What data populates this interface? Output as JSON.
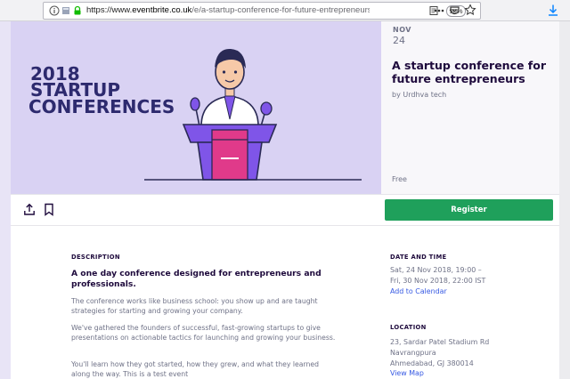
{
  "browser": {
    "url_scheme": "https://www.",
    "url_host": "eventbrite.co.uk",
    "url_path": "/e/a-startup-conference-for-future-entrepreneurs",
    "zoom": "90%"
  },
  "hero": {
    "headline_year": "2018",
    "headline_line1": "STARTUP",
    "headline_line2": "CONFERENCES"
  },
  "event": {
    "month": "NOV",
    "day": "24",
    "title": "A startup conference for future entrepreneurs",
    "organizer": "by Urdhva tech",
    "price": "Free"
  },
  "actions": {
    "register_label": "Register"
  },
  "description": {
    "label": "DESCRIPTION",
    "heading": "A one day conference designed for entrepreneurs and professionals.",
    "paragraphs": [
      "The conference works like business school: you show up and are taught strategies for starting and growing your company.",
      "We've gathered the founders of successful, fast-growing startups to give presentations on actionable tactics for launching and growing your business.",
      "You'll learn how they got started, how they grew, and what they learned along the way. This is a test event"
    ]
  },
  "date_time": {
    "label": "DATE AND TIME",
    "line1": "Sat, 24 Nov 2018, 19:00 –",
    "line2": "Fri, 30 Nov 2018, 22:00 IST",
    "calendar_link": "Add to Calendar"
  },
  "location": {
    "label": "LOCATION",
    "line1": "23, Sardar Patel Stadium Rd",
    "line2": "Navrangpura",
    "line3": "Ahmedabad, GJ 380014",
    "map_link": "View Map"
  },
  "colors": {
    "register_green": "#1fa05b",
    "hero_lavender": "#d9d2f3",
    "headline_navy": "#2d2a6e",
    "podium_purple": "#7f55e8",
    "link_blue": "#3659e3"
  }
}
